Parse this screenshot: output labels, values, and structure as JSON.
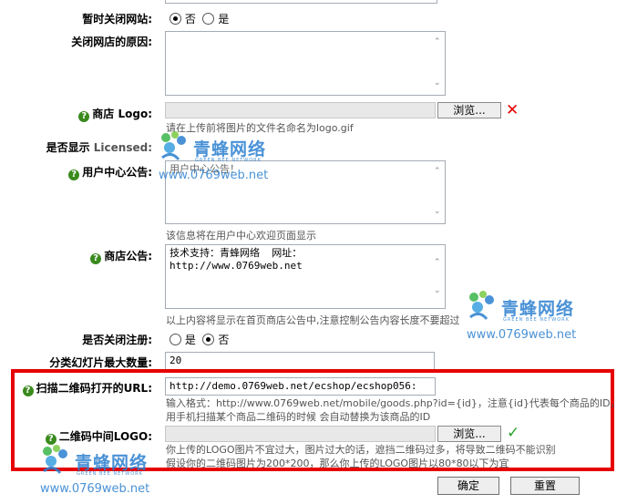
{
  "colors": {
    "accent": "#e60000",
    "help": "#3a8a1e",
    "watermark": "#2b7fd0",
    "check": "#2aa22a"
  },
  "close_shop": {
    "label": "暂时关闭网站:",
    "opt_no": "否",
    "opt_yes": "是"
  },
  "close_reason": {
    "label": "关闭网店的原因:"
  },
  "shop_logo": {
    "label_a": "商店",
    "label_b": "Logo:",
    "browse": "浏览...",
    "note": "请在上传前将图片的文件名命名为logo.gif"
  },
  "licensed": {
    "label_a": "是否显示",
    "label_b": "Licensed:"
  },
  "user_center": {
    "label": "用户中心公告:",
    "value": "用户中心公告！",
    "note": "该信息将在用户中心欢迎页面显示"
  },
  "shop_notice": {
    "label": "商店公告:",
    "value": "技术支持：青蜂网络  网址：\nhttp://www.0769web.net",
    "note": "以上内容将显示在首页商店公告中,注意控制公告内容长度不要超过"
  },
  "close_register": {
    "label": "是否关闭注册:",
    "opt_yes": "是",
    "opt_no": "否"
  },
  "slide_max": {
    "label": "分类幻灯片最大数量:",
    "value": "20"
  },
  "qr_url": {
    "label": "扫描二维码打开的URL:",
    "value": "http://demo.0769web.net/ecshop/ecshop056:",
    "note1": "输入格式：http://www.0769web.net/mobile/goods.php?id={id}，注意{id}代表每个商品的ID，",
    "note2": "用手机扫描某个商品二维码的时候 会自动替换为该商品的ID"
  },
  "qr_logo": {
    "label": "二维码中间LOGO:",
    "browse": "浏览...",
    "note1": "你上传的LOGO图片不宜过大，图片过大的话，遮挡二维码过多，将导致二维码不能识别",
    "note2": "假设你的二维码图片为200*200，那么你上传的LOGO图片以80*80以下为宜"
  },
  "buttons": {
    "submit": "确定",
    "reset": "重置"
  },
  "watermark": {
    "brand": "青蜂网络",
    "sub": "GREEN BEE NETWORK",
    "url": "www.0769web.net"
  },
  "icons": {
    "help": "help-icon",
    "delete": "close-icon",
    "check": "check-icon"
  }
}
